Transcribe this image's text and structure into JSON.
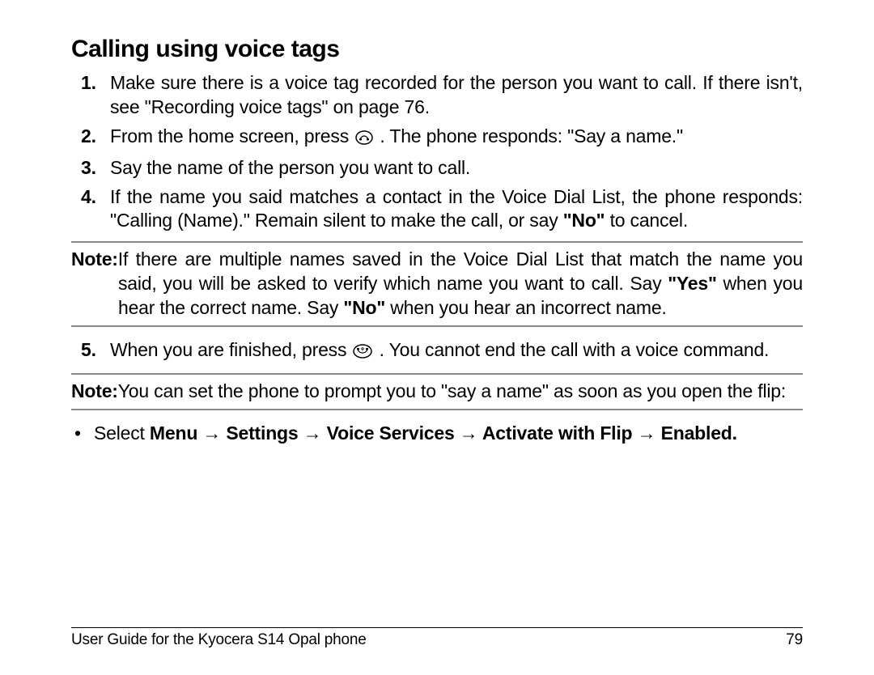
{
  "heading": "Calling using voice tags",
  "steps": {
    "s1": "Make sure there is a voice tag recorded for the person you want to call. If there isn't, see \"Recording voice tags\" on page 76.",
    "s2a": "From the home screen, press ",
    "s2b": " . The phone responds: \"Say a name.\"",
    "s3": "Say the name of the person you want to call.",
    "s4a": "If the name you said matches a contact in the Voice Dial List, the phone responds: \"Calling (Name).\" Remain silent to make the call, or say ",
    "s4_no": "\"No\"",
    "s4b": " to cancel.",
    "s5a": "When you are finished, press ",
    "s5b": " . You cannot end the call with a voice command."
  },
  "note1": {
    "label": "Note:",
    "t1": "If there are multiple names saved in the Voice Dial List that match the name you said, you will be asked to verify which name you want to call. Say ",
    "yes": "\"Yes\"",
    "t2": " when you hear the correct name. Say ",
    "no": "\"No\"",
    "t3": " when you hear an incorrect name."
  },
  "note2": {
    "label": "Note:",
    "t1": "You can set the phone to prompt you to \"say a name\" as soon as you open the flip:"
  },
  "bullet": {
    "pre": "Select ",
    "path": "Menu → Settings → Voice Services → Activate with Flip → Enabled."
  },
  "footer": {
    "left": "User Guide for the Kyocera S14 Opal phone",
    "right": "79"
  }
}
